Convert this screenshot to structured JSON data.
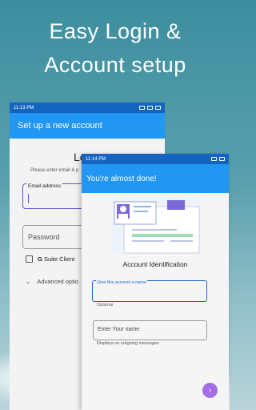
{
  "hero": {
    "line1": "Easy Login &",
    "line2": "Account setup"
  },
  "back_phone": {
    "time": "11:13 PM",
    "app_bar_title": "Set up a new account",
    "heading": "Lo",
    "subtitle": "Please enter email & p",
    "email_label": "Email address",
    "password_placeholder": "Password",
    "gsuite_prefix": "G",
    "gsuite_label": "Suite Client",
    "advanced_label": "Advanced optio"
  },
  "front_phone": {
    "time": "11:14 PM",
    "app_bar_title": "You're almost done!",
    "section_title": "Account Identification",
    "account_name_label": "Give this account a name",
    "account_name_helper": "Optional",
    "your_name_placeholder": "Enter Your name",
    "your_name_helper": "Displays on outgoing messages"
  },
  "colors": {
    "accent": "#2196f3",
    "status_bar": "#1565c0",
    "focus": "#1e63c8",
    "fab": "#a26ee6"
  }
}
